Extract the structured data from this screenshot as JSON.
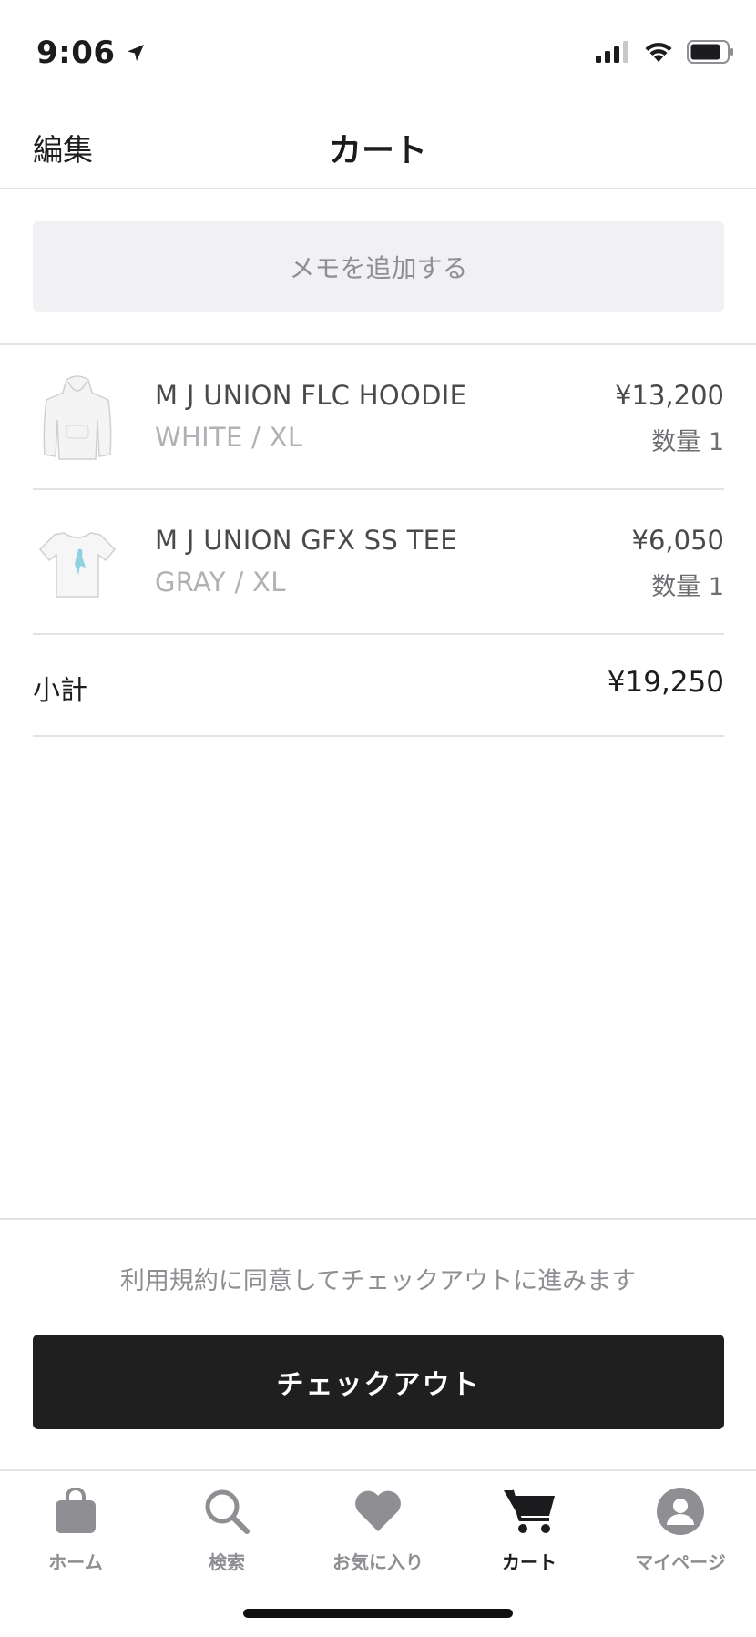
{
  "status_bar": {
    "time": "9:06"
  },
  "nav": {
    "edit_label": "編集",
    "title": "カート"
  },
  "memo": {
    "label": "メモを追加する"
  },
  "items": [
    {
      "name": "M J UNION FLC HOODIE",
      "variant": "WHITE / XL",
      "price": "¥13,200",
      "quantity": "数量 1"
    },
    {
      "name": "M J UNION GFX SS TEE",
      "variant": "GRAY / XL",
      "price": "¥6,050",
      "quantity": "数量 1"
    }
  ],
  "subtotal": {
    "label": "小計",
    "value": "¥19,250"
  },
  "footer": {
    "terms_text": "利用規約に同意してチェックアウトに進みます",
    "checkout_label": "チェックアウト"
  },
  "tab_bar": {
    "tabs": [
      {
        "label": "ホーム",
        "icon": "shopping-bag-icon"
      },
      {
        "label": "検索",
        "icon": "search-icon"
      },
      {
        "label": "お気に入り",
        "icon": "heart-icon"
      },
      {
        "label": "カート",
        "icon": "cart-icon",
        "active": true
      },
      {
        "label": "マイページ",
        "icon": "user-icon"
      }
    ]
  },
  "colors": {
    "accent_dark": "#1f1f1f",
    "tab_inactive": "#8e8e93",
    "divider": "#e3e3e5"
  }
}
